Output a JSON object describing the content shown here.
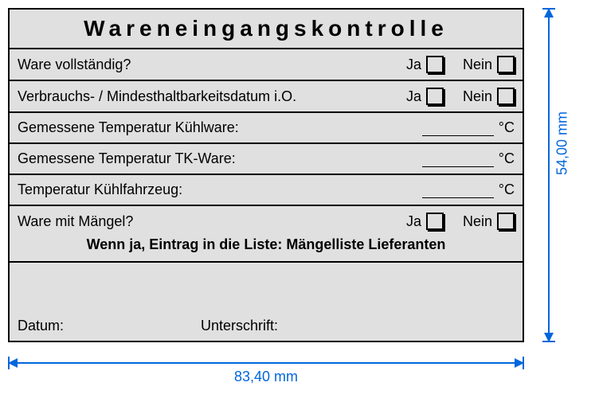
{
  "title": "Wareneingangskontrolle",
  "labels": {
    "yes": "Ja",
    "no": "Nein"
  },
  "rows": {
    "complete": "Ware vollständig?",
    "expiry": "Verbrauchs- / Mindesthaltbarkeitsdatum  i.O.",
    "temp_cool": "Gemessene Temperatur Kühlware:",
    "temp_frozen": "Gemessene Temperatur TK-Ware:",
    "temp_vehicle": "Temperatur Kühlfahrzeug:",
    "defects": "Ware mit Mängel?",
    "defects_note": "Wenn ja, Eintrag in die Liste: Mängelliste Lieferanten",
    "date": "Datum:",
    "signature": "Unterschrift:",
    "unit": "°C"
  },
  "dimensions": {
    "height": "54,00 mm",
    "width": "83,40 mm"
  }
}
